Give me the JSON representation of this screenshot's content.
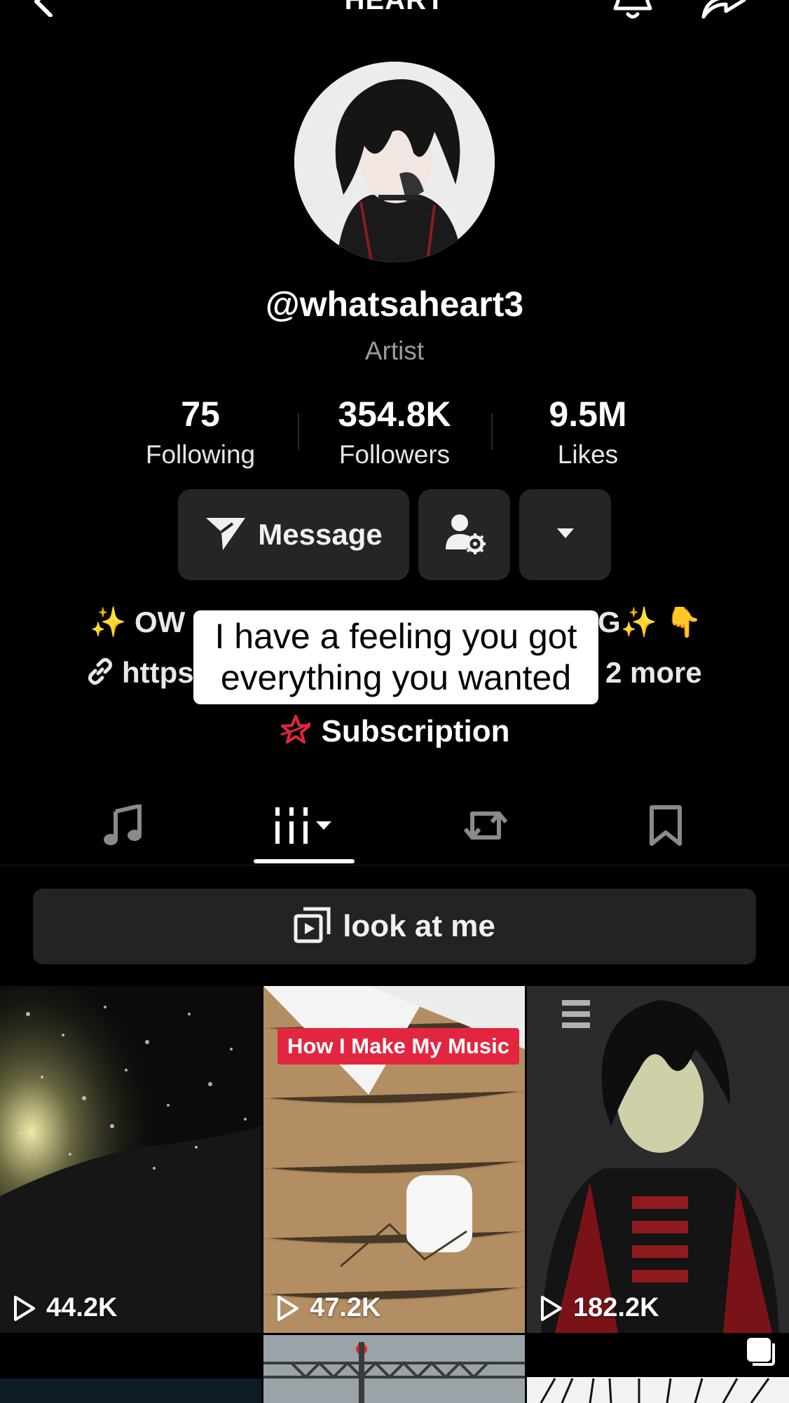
{
  "header": {
    "title": "HEART"
  },
  "profile": {
    "username": "@whatsaheart3",
    "subtitle": "Artist"
  },
  "stats": [
    {
      "value": "75",
      "label": "Following"
    },
    {
      "value": "354.8K",
      "label": "Followers"
    },
    {
      "value": "9.5M",
      "label": "Likes"
    }
  ],
  "actions": {
    "message_label": "Message"
  },
  "bio": {
    "line1_start": "✨ OW",
    "line1_end": "G✨ 👇",
    "link_start": "https",
    "more_label": "2 more"
  },
  "caption": {
    "text": "I have a feeling you got everything you wanted"
  },
  "subscription": {
    "label": "Subscription"
  },
  "playlist": {
    "label": "look at me"
  },
  "videos": [
    {
      "views": "44.2K"
    },
    {
      "views": "47.2K",
      "badge": "How I Make My Music"
    },
    {
      "views": "182.2K"
    }
  ],
  "colors": {
    "accent": "#e3263f",
    "background": "#000000",
    "button": "#252525"
  }
}
